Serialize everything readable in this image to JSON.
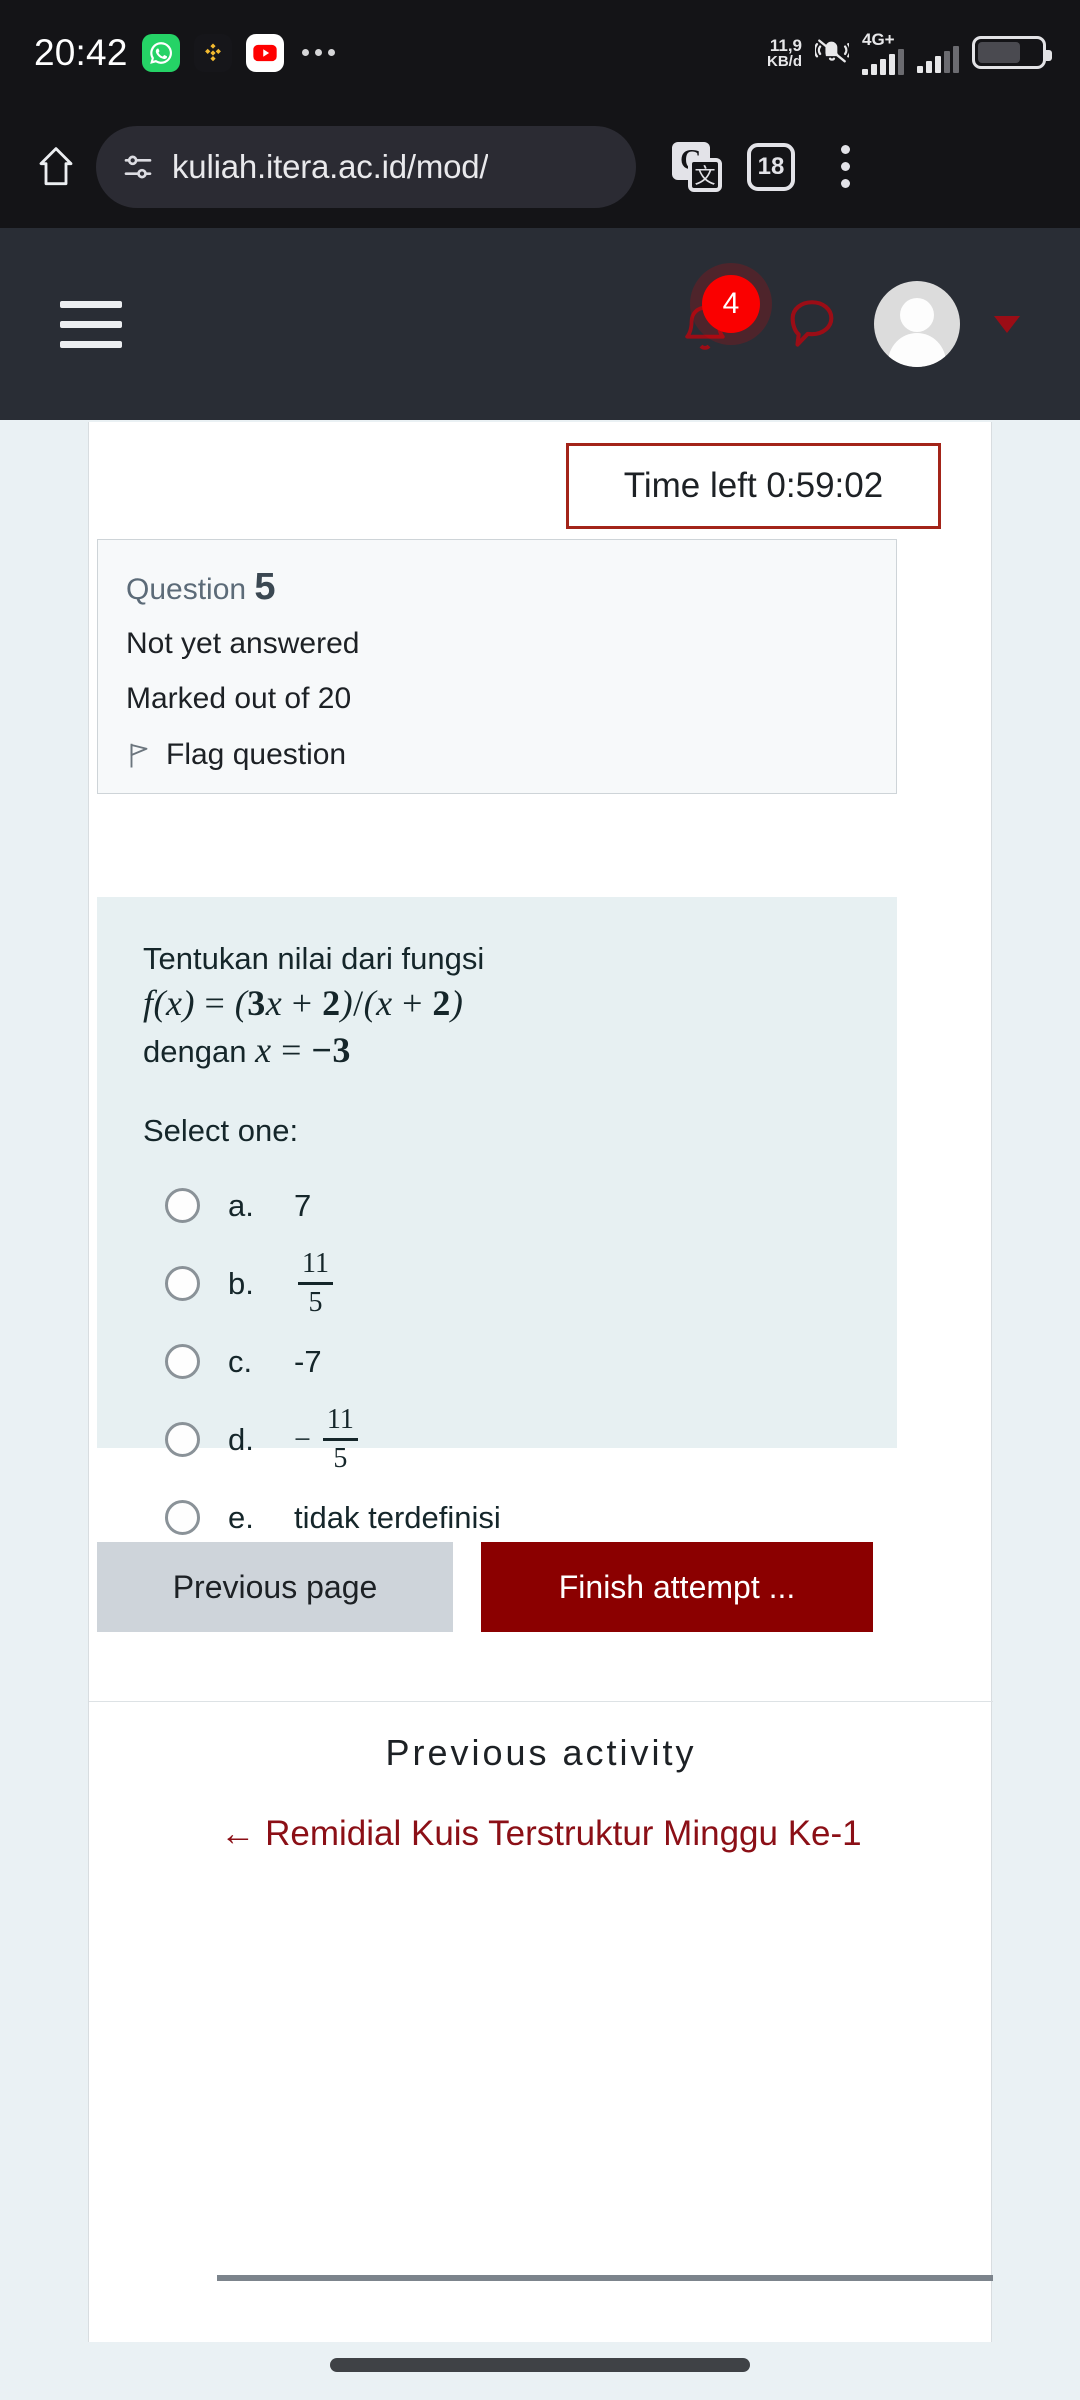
{
  "status_bar": {
    "clock": "20:42",
    "app_icons": [
      "whatsapp-icon",
      "binance-icon",
      "youtube-icon"
    ],
    "overflow": "more-apps-icon",
    "network_rate": "11,9",
    "network_unit": "KB/d",
    "ringer": "mute-icon",
    "mobile_network": "4G+",
    "battery_percent": "70"
  },
  "browser": {
    "home_label": "home-icon",
    "site_settings_icon": "tune-icon",
    "url": "kuliah.itera.ac.id/mod/",
    "translate_icon_letter": "G",
    "translate_icon_glyph": "文",
    "tab_count": "18",
    "menu_icon": "kebab-menu-icon"
  },
  "moodle_nav": {
    "menu_icon": "hamburger-icon",
    "notification_icon": "bell-icon",
    "notification_count": "4",
    "messages_icon": "message-bubble-icon",
    "avatar": "user-avatar",
    "caret": "chevron-down-icon"
  },
  "quiz": {
    "timer_label": "Time left 0:59:02",
    "question_word": "Question",
    "question_number": "5",
    "state": "Not yet answered",
    "marks": "Marked out of 20",
    "flag_label": "Flag question",
    "prompt_line1": "Tentukan nilai dari fungsi",
    "prompt_formula": "f(x) = (3x + 2)/(x + 2)",
    "prompt_line3_prefix": "dengan",
    "prompt_line3_formula": "x = −3",
    "select_one": "Select one:",
    "options": [
      {
        "letter": "a.",
        "text": "7",
        "type": "plain"
      },
      {
        "letter": "b.",
        "numerator": "11",
        "denominator": "5",
        "type": "fraction",
        "sign": ""
      },
      {
        "letter": "c.",
        "text": "-7",
        "type": "plain"
      },
      {
        "letter": "d.",
        "numerator": "11",
        "denominator": "5",
        "type": "fraction",
        "sign": "−"
      },
      {
        "letter": "e.",
        "text": "tidak terdefinisi",
        "type": "plain"
      }
    ],
    "previous_page_label": "Previous page",
    "finish_attempt_label": "Finish attempt ..."
  },
  "previous_activity": {
    "heading": "Previous activity",
    "link_arrow": "←",
    "link_text": "Remidial Kuis Terstruktur Minggu Ke-1"
  },
  "colors": {
    "accent_red": "#8b0000",
    "timer_border": "#a32419",
    "navbar_bg": "#292d35",
    "page_bg": "#eaf1f4",
    "question_bg": "#e7f0f2"
  }
}
